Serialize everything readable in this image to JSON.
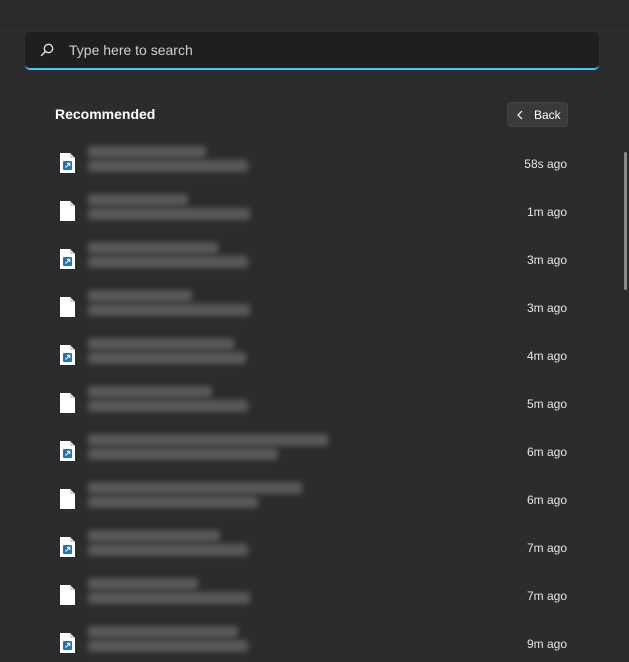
{
  "search": {
    "placeholder": "Type here to search",
    "accent_color": "#4cc2ff",
    "icon": "search-icon"
  },
  "recommended": {
    "title": "Recommended",
    "back_label": "Back",
    "items": [
      {
        "type": "shortcut",
        "time": "58s ago"
      },
      {
        "type": "document",
        "time": "1m ago"
      },
      {
        "type": "shortcut",
        "time": "3m ago"
      },
      {
        "type": "document",
        "time": "3m ago"
      },
      {
        "type": "shortcut",
        "time": "4m ago"
      },
      {
        "type": "document",
        "time": "5m ago"
      },
      {
        "type": "shortcut",
        "time": "6m ago"
      },
      {
        "type": "document",
        "time": "6m ago"
      },
      {
        "type": "shortcut",
        "time": "7m ago"
      },
      {
        "type": "document",
        "time": "7m ago"
      },
      {
        "type": "shortcut",
        "time": "9m ago"
      }
    ]
  }
}
